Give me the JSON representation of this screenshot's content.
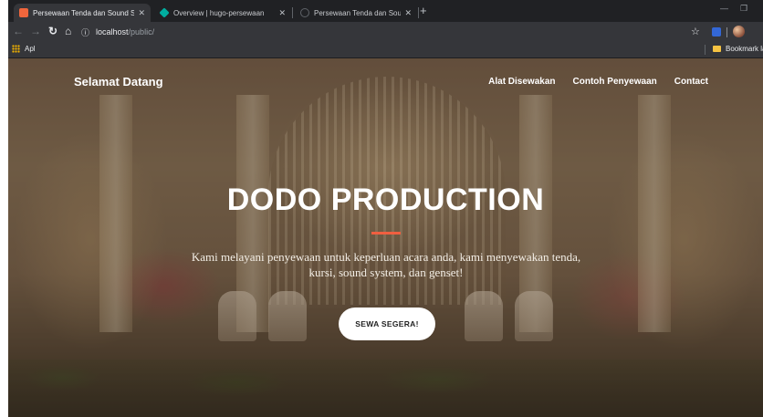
{
  "browser": {
    "tabs": [
      {
        "title": "Persewaan Tenda dan Sound Sys",
        "favicon_color": "#f0663c",
        "active": true
      },
      {
        "title": "Overview | hugo-persewaan",
        "favicon_color": "#00ad9f",
        "active": false
      },
      {
        "title": "Persewaan Tenda dan Sound Sys",
        "favicon_color": "#5f6368",
        "active": false
      }
    ],
    "new_tab_icon": "plus-icon",
    "address": {
      "host": "localhost",
      "path": "/public/"
    },
    "bookmarks": {
      "apps_label": "Apl",
      "folder_label": "Bookmark la"
    }
  },
  "site": {
    "brand": "Selamat Datang",
    "nav": [
      "Alat Disewakan",
      "Contoh Penyewaan",
      "Contact"
    ],
    "hero": {
      "title": "DODO PRODUCTION",
      "subtitle": "Kami melayani penyewaan untuk keperluan acara anda, kami menyewakan tenda, kursi, sound system, dan genset!",
      "cta": "SEWA SEGERA!"
    },
    "accent_color": "#f05f40"
  }
}
